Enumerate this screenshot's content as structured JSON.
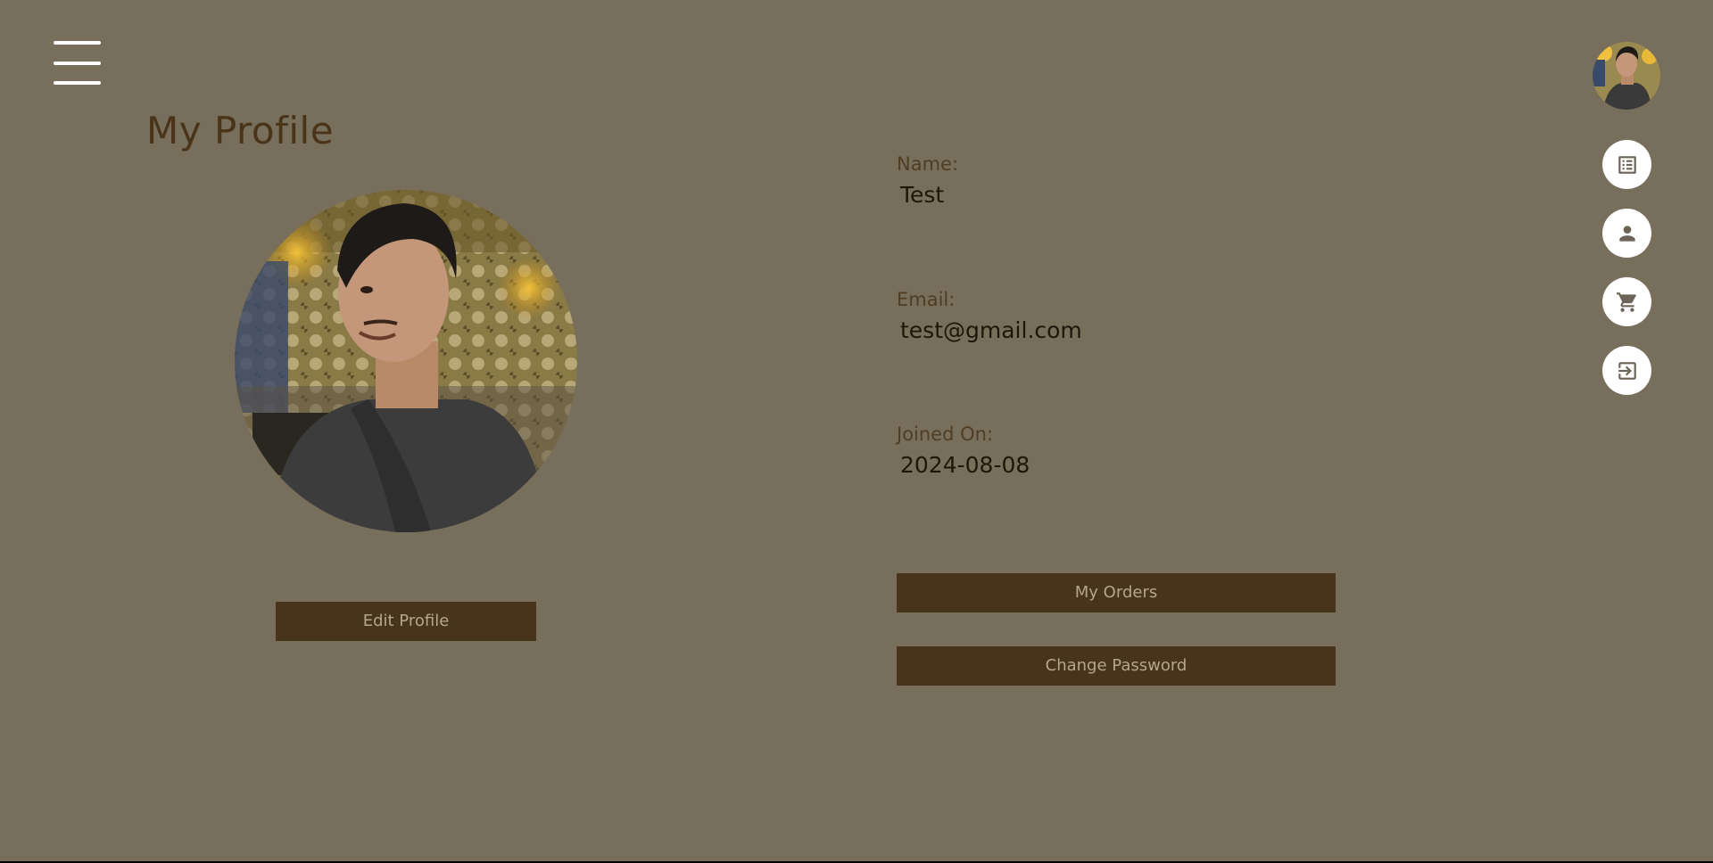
{
  "page": {
    "title": "My Profile"
  },
  "profile": {
    "edit_label": "Edit Profile",
    "name_label": "Name:",
    "name_value": "Test",
    "email_label": "Email:",
    "email_value": "test@gmail.com",
    "joined_label": "Joined On:",
    "joined_value": "2024-08-08"
  },
  "actions": {
    "orders_label": "My Orders",
    "password_label": "Change Password"
  },
  "speed_dial": {
    "items": [
      {
        "icon": "list-icon"
      },
      {
        "icon": "person-icon"
      },
      {
        "icon": "cart-icon"
      },
      {
        "icon": "logout-icon"
      }
    ]
  },
  "colors": {
    "background": "#786e5c",
    "button": "#48331b",
    "button_text": "#b4a68e",
    "title": "#4a3419"
  }
}
